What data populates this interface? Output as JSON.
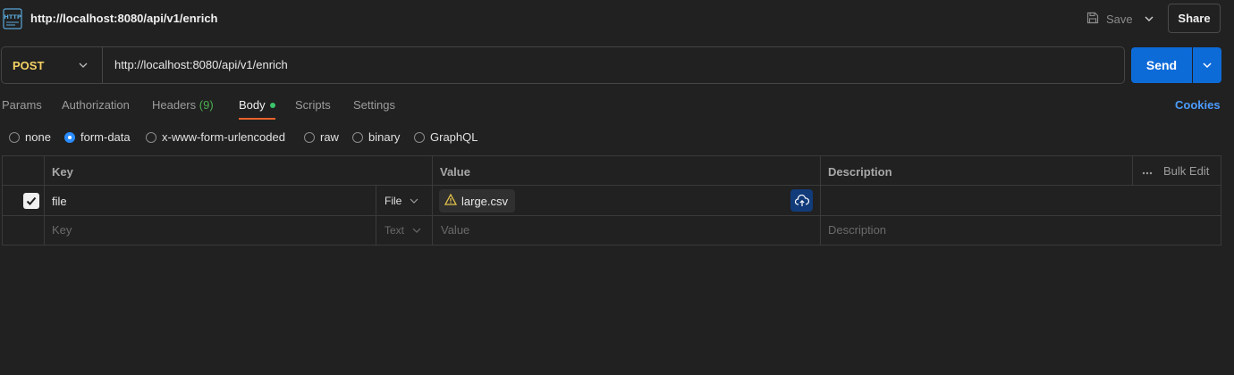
{
  "header": {
    "title": "http://localhost:8080/api/v1/enrich",
    "save_label": "Save",
    "share_label": "Share",
    "icon": "http-icon"
  },
  "request": {
    "method": "POST",
    "url": "http://localhost:8080/api/v1/enrich",
    "send_label": "Send"
  },
  "tabs": {
    "params": "Params",
    "authorization": "Authorization",
    "headers": "Headers",
    "headers_count": "(9)",
    "body": "Body",
    "scripts": "Scripts",
    "settings": "Settings",
    "cookies": "Cookies",
    "active": "Body"
  },
  "body_modes": {
    "options": [
      "none",
      "form-data",
      "x-www-form-urlencoded",
      "raw",
      "binary",
      "GraphQL"
    ],
    "selected": "form-data"
  },
  "table": {
    "headers": {
      "key": "Key",
      "value": "Value",
      "description": "Description",
      "bulk_edit": "Bulk Edit"
    },
    "rows": [
      {
        "checked": true,
        "key": "file",
        "type": "File",
        "value": "large.csv",
        "description": ""
      }
    ],
    "placeholder": {
      "key": "Key",
      "type": "Text",
      "value": "Value",
      "description": "Description"
    }
  },
  "colors": {
    "method": "#f5d265",
    "send": "#0d6bd8",
    "active_tab_underline": "#e8632b",
    "cookies": "#4c9cff",
    "body_dot": "#3cc46b"
  }
}
